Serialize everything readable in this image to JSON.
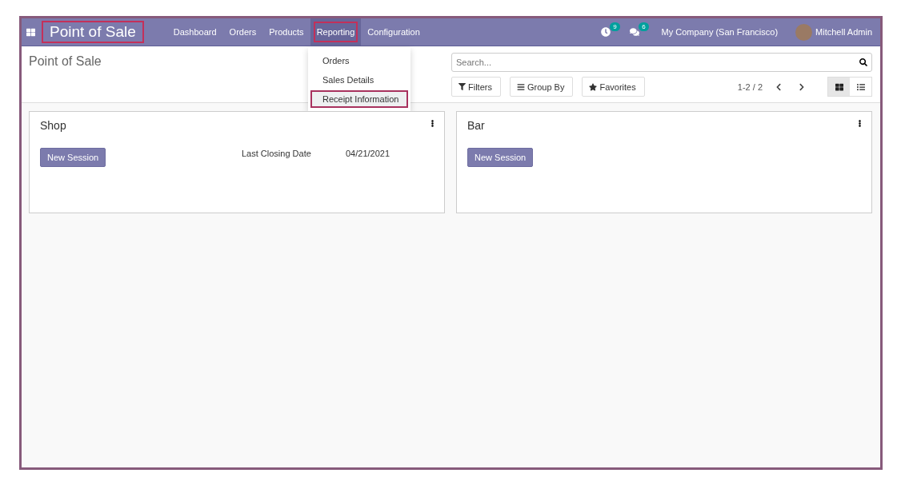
{
  "navbar": {
    "app_title": {
      "text": "Point of Sale",
      "highlighted": true
    },
    "menu": [
      {
        "label": "Dashboard",
        "selected": false,
        "highlighted": false
      },
      {
        "label": "Orders",
        "selected": false,
        "highlighted": false
      },
      {
        "label": "Products",
        "selected": false,
        "highlighted": false
      },
      {
        "label": "Reporting",
        "selected": true,
        "highlighted": true
      },
      {
        "label": "Configuration",
        "selected": false,
        "highlighted": false
      }
    ],
    "activity_count": "9",
    "message_count": "6",
    "company": "My Company (San Francisco)",
    "user": "Mitchell Admin"
  },
  "dropdown": {
    "items": [
      {
        "label": "Orders",
        "highlighted": false
      },
      {
        "label": "Sales Details",
        "highlighted": false
      },
      {
        "label": "Receipt Information",
        "highlighted": true
      }
    ]
  },
  "control_panel": {
    "title": "Point of Sale",
    "search": {
      "placeholder": "Search..."
    },
    "buttons": [
      {
        "kind": "filter",
        "label": "Filters"
      },
      {
        "kind": "group",
        "label": "Group By"
      },
      {
        "kind": "star",
        "label": "Favorites"
      }
    ],
    "pager": "1-2 / 2",
    "views": [
      {
        "kind": "kanban",
        "selected": true
      },
      {
        "kind": "list",
        "selected": false
      }
    ]
  },
  "cards": [
    {
      "name": "Shop",
      "button": "New Session",
      "fields": [
        {
          "label": "Last Closing Date",
          "value": "04/21/2021"
        }
      ]
    },
    {
      "name": "Bar",
      "button": "New Session"
    }
  ]
}
